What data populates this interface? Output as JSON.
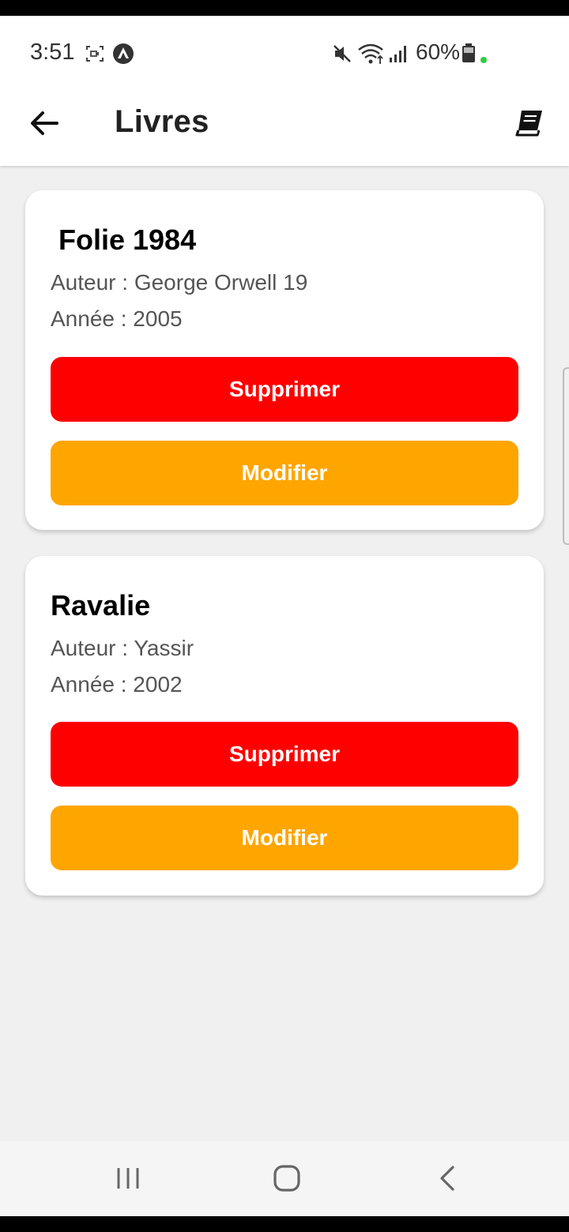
{
  "status_bar": {
    "time": "3:51",
    "battery": "60%",
    "icons": [
      "screen-record-icon",
      "app-notification-icon",
      "mute-icon",
      "wifi-icon",
      "signal-icon",
      "battery-icon"
    ],
    "accent_dot": "#2ecc40"
  },
  "app_bar": {
    "title": "Livres",
    "back_icon": "arrow-left-icon",
    "action_icon": "book-icon"
  },
  "books": [
    {
      "title": "Folie 1984",
      "author": "Auteur : George Orwell 19",
      "year": "Année : 2005",
      "delete_label": "Supprimer",
      "edit_label": "Modifier"
    },
    {
      "title": "Ravalie",
      "author": "Auteur : Yassir",
      "year": "Année : 2002",
      "delete_label": "Supprimer",
      "edit_label": "Modifier"
    }
  ],
  "colors": {
    "delete": "#ff0000",
    "edit": "#ffa500",
    "background": "#f0f0f0"
  },
  "nav_bar": {
    "icons": [
      "recent-apps-icon",
      "home-icon",
      "back-icon"
    ]
  }
}
